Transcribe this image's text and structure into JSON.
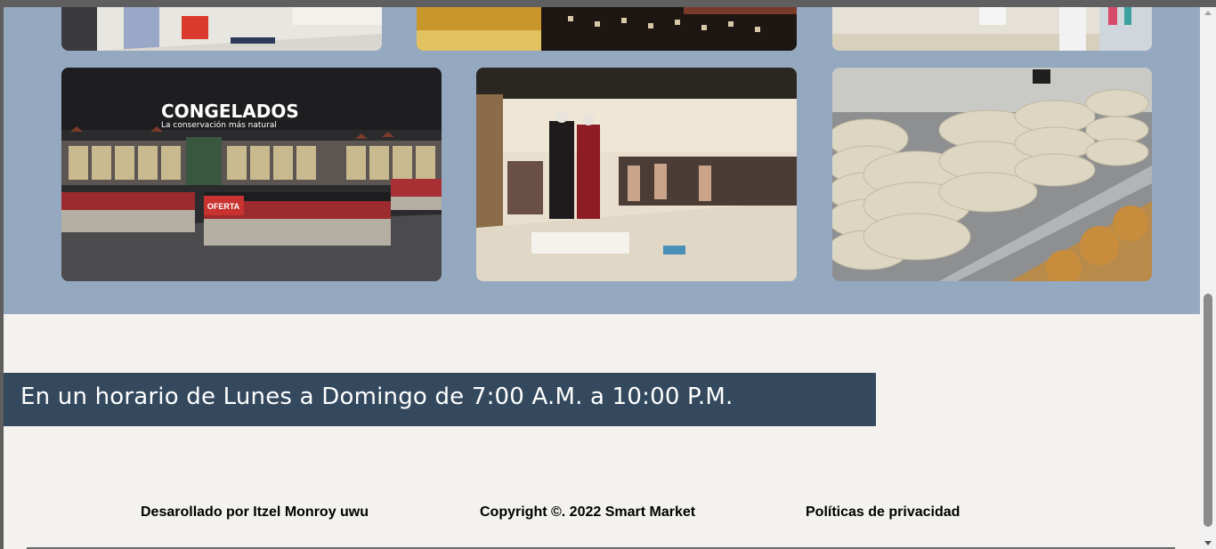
{
  "gallery": {
    "images": [
      {
        "name": "store-aisle-shopper-photo"
      },
      {
        "name": "wine-shelves-photo"
      },
      {
        "name": "pharmacy-shelves-photo"
      },
      {
        "name": "frozen-section-photo",
        "sign_title": "CONGELADOS",
        "sign_subtitle": "La conservación más natural",
        "offer_label": "OFERTA"
      },
      {
        "name": "clothing-store-photo"
      },
      {
        "name": "tortillas-shelf-photo"
      }
    ]
  },
  "hours": {
    "text": "En un horario de Lunes a Domingo de 7:00 A.M. a 10:00 P.M."
  },
  "footer": {
    "developer": "Desarollado por Itzel Monroy uwu",
    "copyright": "Copyright ©. 2022 Smart Market",
    "privacy": "Políticas de privacidad"
  },
  "colors": {
    "gallery_bg": "#94a8c0",
    "hours_band": "#34495e",
    "page_bg": "#f3f2ef"
  }
}
